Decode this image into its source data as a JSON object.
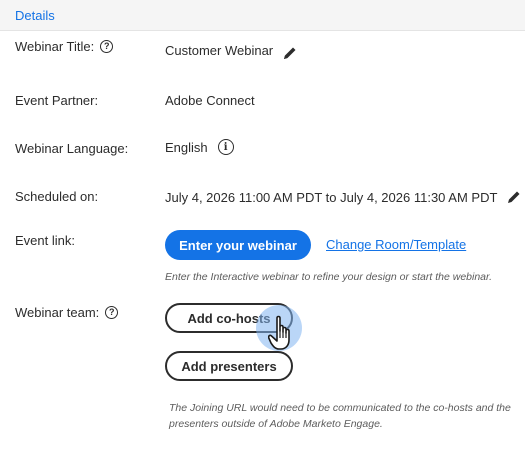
{
  "header": {
    "tab_label": "Details"
  },
  "fields": {
    "title_label": "Webinar Title:",
    "title_value": "Customer Webinar",
    "partner_label": "Event Partner:",
    "partner_value": "Adobe Connect",
    "language_label": "Webinar Language:",
    "language_value": "English",
    "scheduled_label": "Scheduled on:",
    "scheduled_value": "July 4, 2026 11:00 AM PDT to July 4, 2026 11:30 AM PDT",
    "event_link_label": "Event link:",
    "team_label": "Webinar team:"
  },
  "actions": {
    "enter_webinar": "Enter your webinar",
    "change_room": "Change Room/Template",
    "add_cohosts": "Add co-hosts",
    "add_presenters": "Add presenters"
  },
  "hints": {
    "event_link_hint": "Enter the Interactive webinar to refine your design or start the webinar.",
    "team_hint_line1": "The Joining URL would need to be communicated to the co-hosts and the",
    "team_hint_line2": "presenters outside of Adobe Marketo Engage."
  },
  "icons": {
    "help": "question-circle-icon",
    "info": "info-circle-icon",
    "edit": "pencil-icon",
    "cursor": "hand-pointer-icon"
  },
  "colors": {
    "accent": "#1473e6",
    "text": "#2c2c2c",
    "header_bg": "#f5f5f5"
  }
}
